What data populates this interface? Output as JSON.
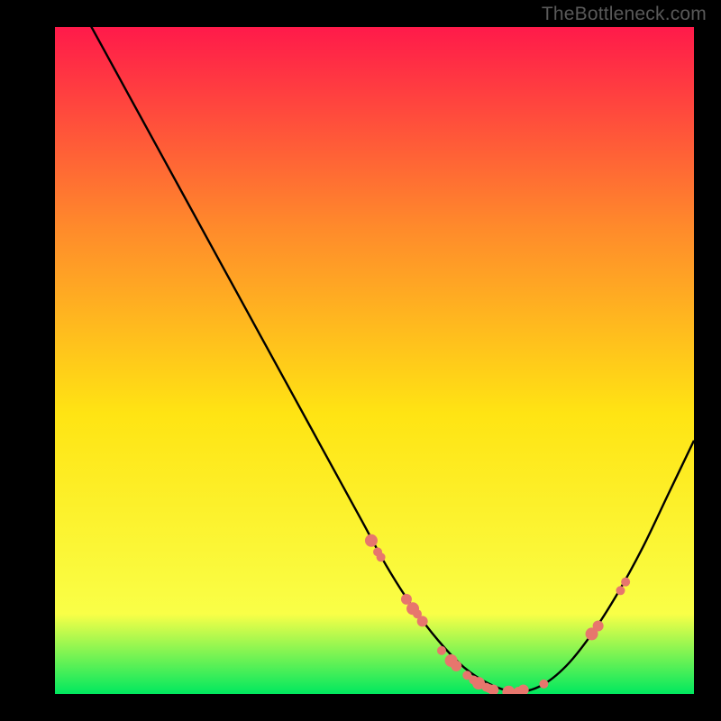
{
  "attribution": "TheBottleneck.com",
  "colors": {
    "frame": "#000000",
    "gradient_top": "#ff1a4a",
    "gradient_mid_upper": "#ff8a2b",
    "gradient_mid": "#ffe413",
    "gradient_lower": "#f9ff47",
    "gradient_bottom": "#00e85f",
    "curve": "#000000",
    "marker_fill": "#e7766d",
    "marker_stroke": "#e7766d"
  },
  "chart_data": {
    "type": "line",
    "title": "",
    "xlabel": "",
    "ylabel": "",
    "xlim": [
      0,
      100
    ],
    "ylim": [
      0,
      100
    ],
    "curve": {
      "x": [
        0,
        4,
        8,
        12,
        16,
        20,
        24,
        28,
        32,
        36,
        40,
        44,
        48,
        52,
        56,
        60,
        64,
        68,
        72,
        76,
        80,
        84,
        88,
        92,
        96,
        100
      ],
      "y": [
        110,
        103,
        96,
        89,
        82,
        75,
        68,
        61,
        54,
        47,
        40,
        33,
        26,
        19,
        13,
        8,
        4,
        1.5,
        0.3,
        1.2,
        4.2,
        9,
        15,
        22,
        30,
        38
      ]
    },
    "markers": [
      {
        "x": 49.5,
        "y": 23
      },
      {
        "x": 50.5,
        "y": 21.3
      },
      {
        "x": 51.0,
        "y": 20.5
      },
      {
        "x": 55.0,
        "y": 14.2
      },
      {
        "x": 56.0,
        "y": 12.8
      },
      {
        "x": 56.7,
        "y": 12.0
      },
      {
        "x": 57.5,
        "y": 10.9
      },
      {
        "x": 60.5,
        "y": 6.5
      },
      {
        "x": 62.0,
        "y": 5.0
      },
      {
        "x": 62.8,
        "y": 4.2
      },
      {
        "x": 64.5,
        "y": 2.8
      },
      {
        "x": 65.5,
        "y": 2.1
      },
      {
        "x": 66.3,
        "y": 1.6
      },
      {
        "x": 67.5,
        "y": 1.0
      },
      {
        "x": 68.0,
        "y": 0.8
      },
      {
        "x": 68.6,
        "y": 0.6
      },
      {
        "x": 71.0,
        "y": 0.3
      },
      {
        "x": 72.5,
        "y": 0.4
      },
      {
        "x": 73.3,
        "y": 0.6
      },
      {
        "x": 76.5,
        "y": 1.5
      },
      {
        "x": 84.0,
        "y": 9.0
      },
      {
        "x": 85.0,
        "y": 10.2
      },
      {
        "x": 88.5,
        "y": 15.5
      },
      {
        "x": 89.3,
        "y": 16.8
      }
    ],
    "marker_radius_major": 7,
    "marker_radius_minor": 5
  }
}
